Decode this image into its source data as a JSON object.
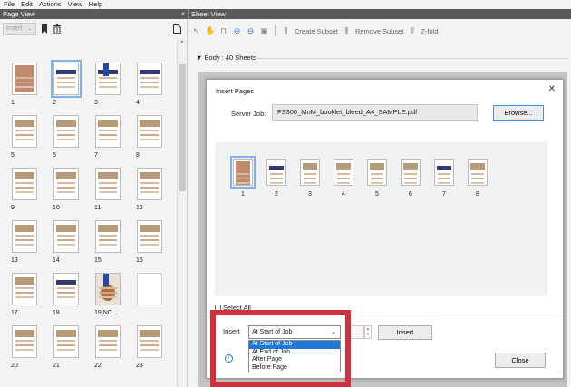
{
  "menu": [
    "File",
    "Edit",
    "Actions",
    "View",
    "Help"
  ],
  "page_view": {
    "title": "Page View",
    "collapse_glyph": "«",
    "insert_label": "Insert",
    "thumbnails": [
      {
        "label": "1",
        "style": "t-cover"
      },
      {
        "label": "2",
        "style": "t-navy",
        "selected": true
      },
      {
        "label": "3",
        "style": "t-navy t-flag"
      },
      {
        "label": "4",
        "style": "t-navy"
      },
      {
        "label": "5",
        "style": "t-plain"
      },
      {
        "label": "6",
        "style": "t-plain"
      },
      {
        "label": "7",
        "style": "t-plain"
      },
      {
        "label": "8",
        "style": "t-plain"
      },
      {
        "label": "9",
        "style": "t-plain"
      },
      {
        "label": "10",
        "style": "t-plain"
      },
      {
        "label": "11",
        "style": "t-plain"
      },
      {
        "label": "12",
        "style": "t-plain"
      },
      {
        "label": "13",
        "style": "t-plain"
      },
      {
        "label": "14",
        "style": "t-plain"
      },
      {
        "label": "15",
        "style": "t-plain"
      },
      {
        "label": "16",
        "style": "t-plain"
      },
      {
        "label": "17",
        "style": "t-plain"
      },
      {
        "label": "18",
        "style": "t-navy"
      },
      {
        "label": "19[NC...",
        "style": "t-photo t-flag"
      },
      {
        "label": "",
        "style": "t-blank"
      },
      {
        "label": "20",
        "style": "t-plain"
      },
      {
        "label": "21",
        "style": "t-plain"
      },
      {
        "label": "22",
        "style": "t-plain"
      },
      {
        "label": "23",
        "style": "t-plain"
      }
    ]
  },
  "sheet_view": {
    "title": "Sheet View",
    "toolbar": {
      "create_subset": "Create Subset",
      "remove_subset": "Remove Subset",
      "z_fold": "Z-fold"
    },
    "body_label": "Body : 40 Sheets"
  },
  "dialog": {
    "title": "Insert Pages",
    "server_job_label": "Server Job:",
    "server_job_value": "FS300_MnM_booklet_bleed_A4_SAMPLE.pdf",
    "browse_label": "Browse...",
    "pages": [
      {
        "label": "1",
        "style": "t-cover",
        "selected": true
      },
      {
        "label": "2",
        "style": "t-navy"
      },
      {
        "label": "3",
        "style": "t-plain"
      },
      {
        "label": "4",
        "style": "t-plain"
      },
      {
        "label": "5",
        "style": "t-plain"
      },
      {
        "label": "6",
        "style": "t-plain"
      },
      {
        "label": "7",
        "style": "t-navy"
      },
      {
        "label": "8",
        "style": "t-plain"
      }
    ],
    "select_all_label": "Select All",
    "insert_label": "Insert",
    "position_selected": "At Start of Job",
    "position_options": [
      "At Start of Job",
      "At End of Job",
      "After Page",
      "Before Page"
    ],
    "insert_button": "Insert",
    "close_button": "Close"
  },
  "colors": {
    "highlight": "#d32f3f",
    "selection": "#1e78d6",
    "panel_header": "#5a5a5a"
  }
}
